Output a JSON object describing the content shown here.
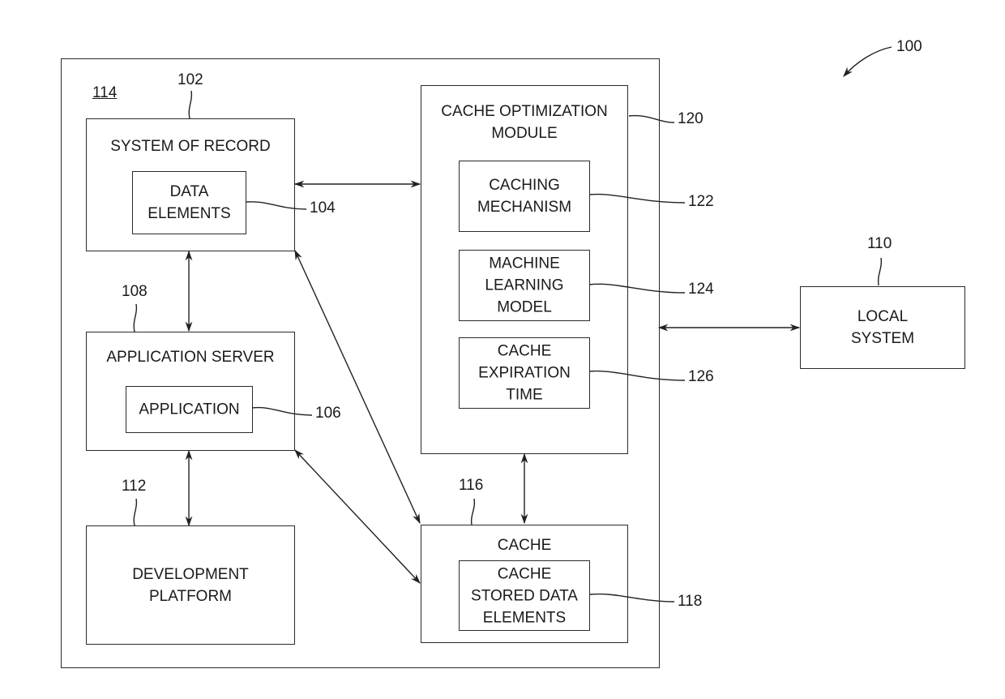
{
  "figure": {
    "ref": "100",
    "environment": {
      "ref": "114"
    },
    "system_of_record": {
      "ref": "102",
      "title": "SYSTEM OF RECORD",
      "data_elements": {
        "ref": "104",
        "label": "DATA\nELEMENTS"
      }
    },
    "application_server": {
      "ref": "108",
      "title": "APPLICATION SERVER",
      "application": {
        "ref": "106",
        "label": "APPLICATION"
      }
    },
    "development_platform": {
      "ref": "112",
      "label": "DEVELOPMENT\nPLATFORM"
    },
    "cache_optimization_module": {
      "ref": "120",
      "title": "CACHE OPTIMIZATION\nMODULE",
      "caching_mechanism": {
        "ref": "122",
        "label": "CACHING\nMECHANISM"
      },
      "machine_learning_model": {
        "ref": "124",
        "label": "MACHINE\nLEARNING\nMODEL"
      },
      "cache_expiration_time": {
        "ref": "126",
        "label": "CACHE\nEXPIRATION\nTIME"
      }
    },
    "cache": {
      "ref": "116",
      "title": "CACHE",
      "cache_stored_data_elements": {
        "ref": "118",
        "label": "CACHE\nSTORED DATA\nELEMENTS"
      }
    },
    "local_system": {
      "ref": "110",
      "label": "LOCAL\nSYSTEM"
    },
    "connections": [
      {
        "from": "system_of_record",
        "to": "cache_optimization_module",
        "type": "bidirectional"
      },
      {
        "from": "system_of_record",
        "to": "application_server",
        "type": "bidirectional"
      },
      {
        "from": "application_server",
        "to": "development_platform",
        "type": "bidirectional"
      },
      {
        "from": "system_of_record",
        "to": "cache",
        "type": "bidirectional"
      },
      {
        "from": "application_server",
        "to": "cache",
        "type": "bidirectional"
      },
      {
        "from": "cache_optimization_module",
        "to": "cache",
        "type": "bidirectional"
      },
      {
        "from": "environment",
        "to": "local_system",
        "type": "bidirectional"
      }
    ]
  }
}
